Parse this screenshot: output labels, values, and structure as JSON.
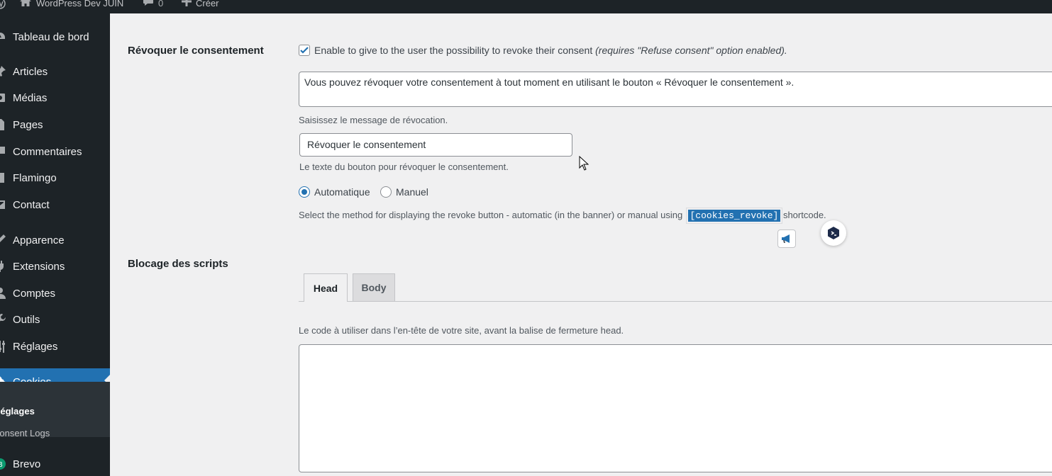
{
  "admin_bar": {
    "site_name": "WordPress Dev JUIN",
    "comments_count": "0",
    "new_label": "Créer"
  },
  "sidebar": {
    "items": [
      {
        "label": "Tableau de bord",
        "icon": "dashboard-icon"
      },
      {
        "label": "Articles",
        "icon": "pin-icon"
      },
      {
        "label": "Médias",
        "icon": "media-icon"
      },
      {
        "label": "Pages",
        "icon": "page-icon"
      },
      {
        "label": "Commentaires",
        "icon": "comment-icon"
      },
      {
        "label": "Flamingo",
        "icon": "flamingo-icon"
      },
      {
        "label": "Contact",
        "icon": "mail-icon"
      },
      {
        "label": "Apparence",
        "icon": "brush-icon"
      },
      {
        "label": "Extensions",
        "icon": "plugin-icon"
      },
      {
        "label": "Comptes",
        "icon": "users-icon"
      },
      {
        "label": "Outils",
        "icon": "wrench-icon"
      },
      {
        "label": "Réglages",
        "icon": "settings-icon"
      },
      {
        "label": "Cookies",
        "icon": "cookie-icon"
      },
      {
        "label": "Brevo",
        "icon": "brevo-icon"
      }
    ],
    "submenu": [
      "Réglages",
      "Consent Logs"
    ]
  },
  "revoke": {
    "title": "Révoquer le consentement",
    "checkbox_checked": true,
    "checkbox_label": "Enable to give to the user the possibility to revoke their consent",
    "checkbox_note": "(requires \"Refuse consent\" option enabled).",
    "message_value": "Vous pouvez révoquer votre consentement à tout moment en utilisant le bouton « Révoquer le consentement ».",
    "message_desc": "Saisissez le message de révocation.",
    "button_text_value": "Révoquer le consentement",
    "button_text_desc": "Le texte du bouton pour révoquer le consentement.",
    "radio_options": [
      "Automatique",
      "Manuel"
    ],
    "radio_selected": "Automatique",
    "method_desc_before": "Select the method for displaying the revoke button - automatic (in the banner) or manual using",
    "shortcode": "[cookies_revoke]",
    "method_desc_after": "shortcode."
  },
  "scripts": {
    "title": "Blocage des scripts",
    "tabs": [
      "Head",
      "Body"
    ],
    "active_tab": "Head",
    "head_desc": "Le code à utiliser dans l’en-tête de votre site, avant la balise de fermeture head.",
    "head_code": ""
  },
  "colors": {
    "sidebar_bg": "#1d2327",
    "accent": "#2271b1",
    "content_bg": "#f0f0f1"
  }
}
